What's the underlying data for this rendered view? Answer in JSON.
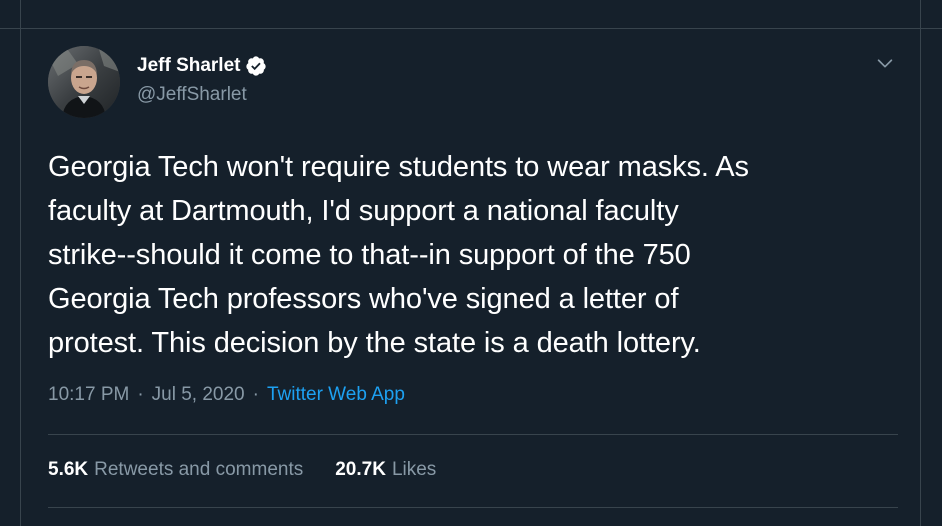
{
  "tweet": {
    "author": {
      "display_name": "Jeff Sharlet",
      "handle": "@JeffSharlet",
      "verified": true
    },
    "text": "Georgia Tech won't require students to wear masks. As\nfaculty at Dartmouth, I'd support a national faculty\nstrike--should it come to that--in support of the 750\nGeorgia Tech professors who've signed a letter of\nprotest. This decision by the state is a death lottery.",
    "time": "10:17 PM",
    "separator": "·",
    "date": "Jul 5, 2020",
    "source": "Twitter Web App",
    "stats": {
      "retweets_count": "5.6K",
      "retweets_label": "Retweets and comments",
      "likes_count": "20.7K",
      "likes_label": "Likes"
    }
  },
  "icons": {
    "verified": "verified-badge-icon",
    "menu": "chevron-down-icon"
  },
  "colors": {
    "background": "#15202b",
    "text_primary": "#ffffff",
    "text_secondary": "#8899a6",
    "link": "#1da1f2",
    "divider": "#38444d"
  }
}
